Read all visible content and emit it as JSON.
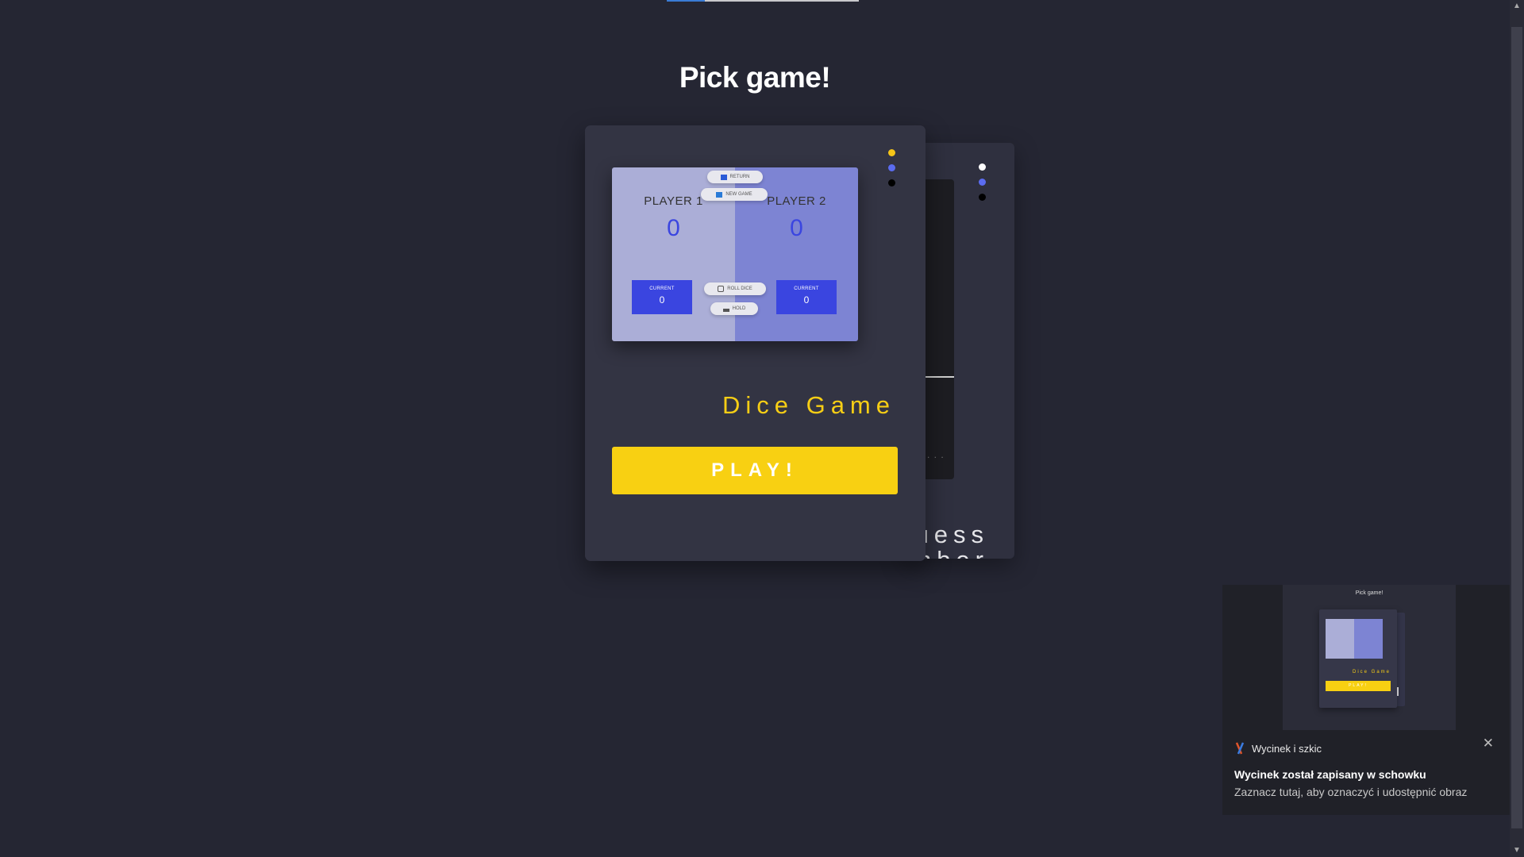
{
  "page": {
    "title": "Pick game!"
  },
  "top_progress": {
    "fraction": 0.2
  },
  "cards": [
    {
      "title": "Dice Game",
      "play_label": "PLAY!",
      "dots": [
        "#f5c518",
        "#5b6cf0",
        "#000000"
      ],
      "preview": {
        "return_label": "RETURN",
        "new_game_label": "NEW GAME",
        "roll_dice_label": "ROLL DICE",
        "hold_label": "HOLD",
        "player1": {
          "name": "PLAYER 1",
          "score": "0",
          "current_label": "CURRENT",
          "current": "0"
        },
        "player2": {
          "name": "PLAYER 2",
          "score": "0",
          "current_label": "CURRENT",
          "current": "0"
        }
      }
    },
    {
      "title_line1": "uess",
      "title_line2": "nber",
      "dots": [
        "#ffffff",
        "#5b6cf0",
        "#000000"
      ]
    }
  ],
  "notification": {
    "preview_title": "Pick game!",
    "preview_card_title": "Dice Game",
    "preview_play": "PLAY!",
    "app_name": "Wycinek i szkic",
    "message_title": "Wycinek został zapisany w schowku",
    "message_subtitle": "Zaznacz tutaj, aby oznaczyć i udostępnić obraz"
  },
  "colors": {
    "background": "#252633",
    "card": "#333443",
    "accent": "#f8d012"
  },
  "icons": {
    "close": "close-icon",
    "app": "snip-sketch-icon"
  }
}
